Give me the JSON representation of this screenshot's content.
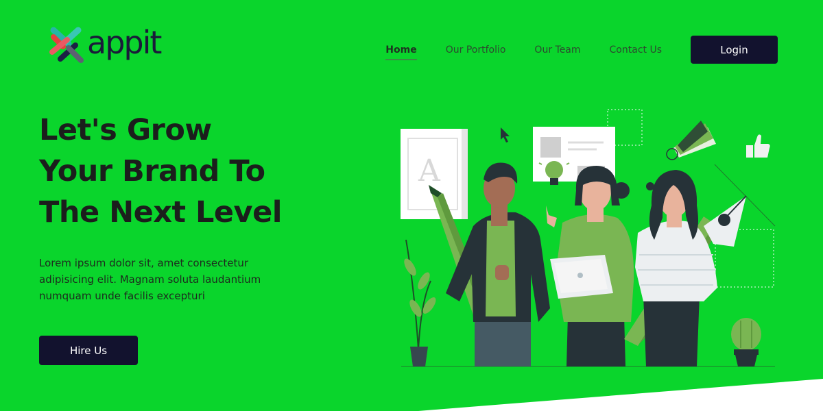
{
  "brand": {
    "name": "appit"
  },
  "nav": {
    "links": [
      {
        "label": "Home",
        "active": true
      },
      {
        "label": "Our Portfolio",
        "active": false
      },
      {
        "label": "Our Team",
        "active": false
      },
      {
        "label": "Contact Us",
        "active": false
      }
    ],
    "login_label": "Login"
  },
  "hero": {
    "title_line1": "Let's Grow",
    "title_line2": "Your Brand To",
    "title_line3": "The Next Level",
    "description": "Lorem ipsum dolor sit, amet consectetur adipisicing elit. Magnam soluta laudantium numquam unde facilis excepturi",
    "cta_label": "Hire Us"
  },
  "illustration": {
    "frame_letter": "A"
  },
  "colors": {
    "background": "#0ad52c",
    "button": "#12122e",
    "accent_green": "#7ab653",
    "dark": "#263238"
  },
  "icons": [
    "logo-icon",
    "cursor-icon",
    "thumbs-up-icon",
    "lightbulb-icon",
    "color-swatch-icon",
    "pen-nib-icon"
  ]
}
